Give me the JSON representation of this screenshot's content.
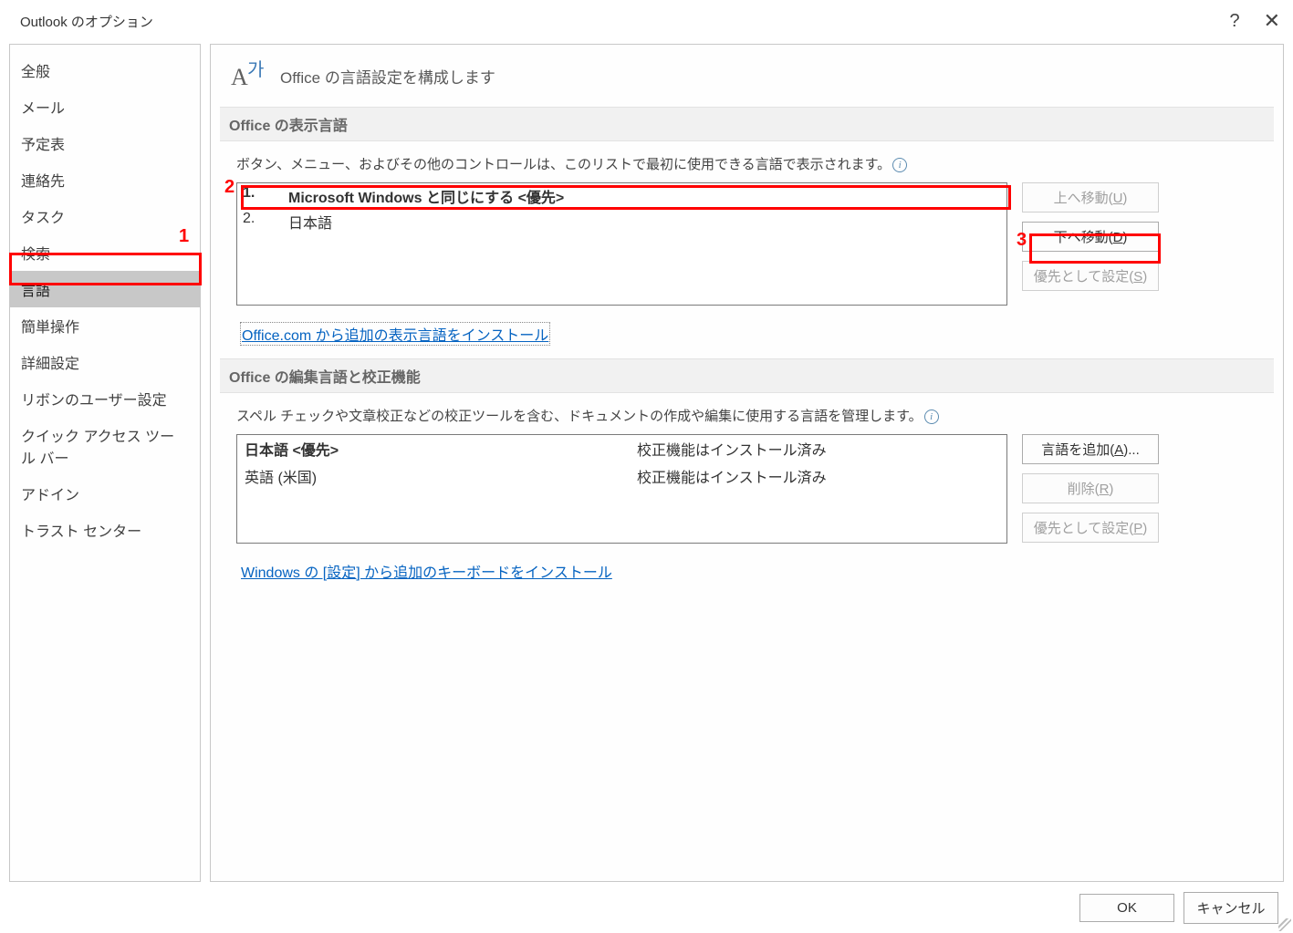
{
  "window": {
    "title": "Outlook のオプション"
  },
  "sidebar": {
    "items": [
      {
        "label": "全般"
      },
      {
        "label": "メール"
      },
      {
        "label": "予定表"
      },
      {
        "label": "連絡先"
      },
      {
        "label": "タスク"
      },
      {
        "label": "検索"
      },
      {
        "label": "言語"
      },
      {
        "label": "簡単操作"
      },
      {
        "label": "詳細設定"
      },
      {
        "label": "リボンのユーザー設定"
      },
      {
        "label": "クイック アクセス ツール バー"
      },
      {
        "label": "アドイン"
      },
      {
        "label": "トラスト センター"
      }
    ],
    "selected_index": 6
  },
  "page": {
    "title": "Office の言語設定を構成します"
  },
  "display": {
    "header": "Office の表示言語",
    "desc": "ボタン、メニュー、およびその他のコントロールは、このリストで最初に使用できる言語で表示されます。",
    "items": [
      {
        "num": "1.",
        "label": "Microsoft Windows と同じにする <優先>",
        "selected": true
      },
      {
        "num": "2.",
        "label": "日本語",
        "selected": false
      }
    ],
    "buttons": {
      "up_pre": "上へ移動(",
      "up_key": "U",
      "up_post": ")",
      "down_pre": "下へ移動(",
      "down_key": "D",
      "down_post": ")",
      "pref_pre": "優先として設定(",
      "pref_key": "S",
      "pref_post": ")"
    },
    "link": "Office.com から追加の表示言語をインストール"
  },
  "edit": {
    "header": "Office の編集言語と校正機能",
    "desc": "スペル チェックや文章校正などの校正ツールを含む、ドキュメントの作成や編集に使用する言語を管理します。",
    "items": [
      {
        "lang": "日本語 <優先>",
        "status": "校正機能はインストール済み",
        "bold": true
      },
      {
        "lang": "英語 (米国)",
        "status": "校正機能はインストール済み",
        "bold": false
      }
    ],
    "buttons": {
      "add_pre": "言語を追加(",
      "add_key": "A",
      "add_post": ")...",
      "del_pre": "削除(",
      "del_key": "R",
      "del_post": ")",
      "pref_pre": "優先として設定(",
      "pref_key": "P",
      "pref_post": ")"
    },
    "link": "Windows の [設定] から追加のキーボードをインストール"
  },
  "footer": {
    "ok": "OK",
    "cancel": "キャンセル"
  },
  "annotations": {
    "one": "1",
    "two": "2",
    "three": "3"
  }
}
